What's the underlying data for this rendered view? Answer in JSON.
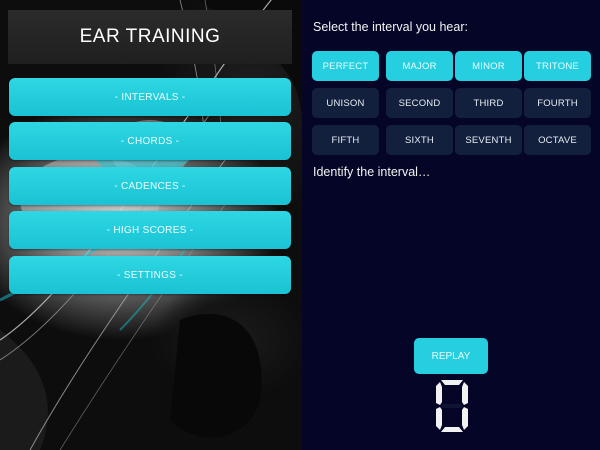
{
  "menu": {
    "title": "EAR TRAINING",
    "items": [
      {
        "label": "- INTERVALS -"
      },
      {
        "label": "- CHORDS -"
      },
      {
        "label": "- CADENCES -"
      },
      {
        "label": "- HIGH SCORES -"
      },
      {
        "label": "- SETTINGS -"
      }
    ]
  },
  "quiz": {
    "prompt": "Select the interval you hear:",
    "quality_buttons": [
      {
        "label": "PERFECT"
      },
      {
        "label": "MAJOR"
      },
      {
        "label": "MINOR"
      },
      {
        "label": "TRITONE"
      }
    ],
    "interval_buttons": [
      {
        "label": "UNISON"
      },
      {
        "label": "SECOND"
      },
      {
        "label": "THIRD"
      },
      {
        "label": "FOURTH"
      },
      {
        "label": "FIFTH"
      },
      {
        "label": "SIXTH"
      },
      {
        "label": "SEVENTH"
      },
      {
        "label": "OCTAVE"
      }
    ],
    "status": "Identify the interval…",
    "replay_label": "REPLAY",
    "score": "0"
  },
  "colors": {
    "accent": "#25cfe0",
    "right_background": "#050527",
    "dark_button": "#13203d",
    "title_box": "#222222"
  },
  "background_image": "cello-strings-photo"
}
